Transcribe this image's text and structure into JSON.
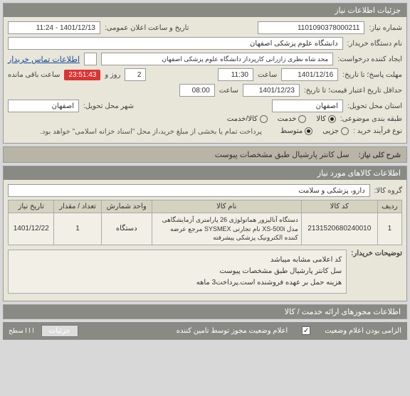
{
  "header": {
    "title": "جزئیات اطلاعات نیاز"
  },
  "fields": {
    "req_number_lbl": "شماره نیاز:",
    "req_number": "1101090378000211",
    "public_date_lbl": "تاریخ و ساعت اعلان عمومی:",
    "public_date": "1401/12/13 - 11:24",
    "buyer_lbl": "نام دستگاه خریدار:",
    "buyer": "دانشگاه علوم پزشکی اصفهان",
    "requester_lbl": "ایجاد کننده درخواست:",
    "requester": "محد شاه نظری زازرانی کارپرداز دانشگاه علوم پزشکی اصفهان",
    "contact_link": "اطلاعات تماس خریدار",
    "deadline_lbl": "مهلت پاسخ؛ تا تاریخ:",
    "deadline_date": "1401/12/16",
    "deadline_time_lbl": "ساعت",
    "deadline_time": "11:30",
    "days_left": "2",
    "days_lbl": "روز و",
    "countdown": "23:51:43",
    "countdown_lbl": "ساعت باقی مانده",
    "validity_lbl": "حداقل تاریخ اعتبار قیمت؛ تا تاریخ:",
    "validity_date": "1401/12/23",
    "validity_time_lbl": "ساعت",
    "validity_time": "08:00",
    "province_lbl": "استان محل تحویل:",
    "province": "اصفهان",
    "city_lbl": "شهر محل تحویل:",
    "city": "اصفهان",
    "category_lbl": "طبقه بندی موضوعی:",
    "cat_goods": "کالا",
    "cat_service": "خدمت",
    "cat_goods_service": "کالا/خدمت",
    "purchase_type_lbl": "نوع فرآیند خرید :",
    "pt_small": "جزیی",
    "pt_medium": "متوسط",
    "payment_note": "پرداخت تمام یا بخشی از مبلغ خرید،از محل \"اسناد خزانه اسلامی\" خواهد بود.",
    "general_desc_lbl": "شرح کلی نیاز:",
    "general_desc": "سل کانتر پارشیال طبق مشخصات پیوست"
  },
  "items_section": {
    "title": "اطلاعات کالاهای مورد نیاز",
    "group_lbl": "گروه کالا:",
    "group": "دارو، پزشکی و سلامت",
    "headers": {
      "row": "ردیف",
      "code": "کد کالا",
      "name": "نام کالا",
      "unit": "واحد شمارش",
      "qty": "تعداد / مقدار",
      "need_date": "تاریخ نیاز"
    },
    "rows": [
      {
        "row": "1",
        "code": "2131520680240010",
        "name": "دستگاه آنالیزور هماتولوژی 26 پارامتری آزمایشگاهی مدل XS-500i نام تجارتی SYSMEX مرجع عرضه کننده الکترونیک پزشکی پیشرفته",
        "unit": "دستگاه",
        "qty": "1",
        "need_date": "1401/12/22"
      }
    ],
    "notes_lbl": "توضیحات خریدار:",
    "notes_l1": "کد اعلامی مشابه میباشد",
    "notes_l2": "سل کانتر پارشیال طبق مشخصات پیوست",
    "notes_l3": "هزینه حمل بر عهده فروشنده است.پرداخت3 ماهه"
  },
  "permits": {
    "title": "اطلاعات مجوزهای ارائه خدمت / کالا"
  },
  "bottom": {
    "mandatory_lbl": "الزامی بودن اعلام وضعیت",
    "status_lbl": "اعلام وضعیت مجوز توسط تامین کننده",
    "details": "جزئیات",
    "levels": "ا ا ا سطح"
  }
}
